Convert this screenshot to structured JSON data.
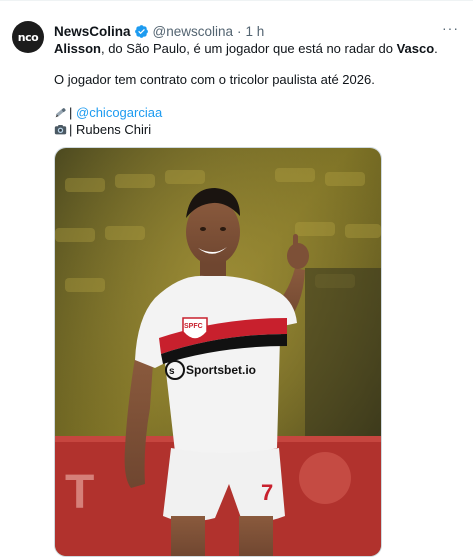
{
  "tweet": {
    "display_name": "NewsColina",
    "handle": "@newscolina",
    "separator": "·",
    "time": "1 h",
    "more": "···",
    "avatar_text": "nco",
    "text": {
      "part1_bold": "Alisson",
      "part1": ", do São Paulo, é um jogador que está no radar do ",
      "part1_bold2": "Vasco",
      "part1_end": ".",
      "line2": "O jogador tem contrato com o tricolor paulista até 2026.",
      "credit_prefix_1": "| ",
      "credit_link": "@chicogarciaa",
      "credit_photo": "| Rubens Chiri"
    },
    "icons": {
      "verified": "verified-badge-icon",
      "pen": "pen-emoji-icon",
      "camera": "camera-emoji-icon"
    },
    "colors": {
      "link": "#1d9bf0",
      "verified": "#1d9bf0",
      "secondary": "#536471"
    },
    "image": {
      "jersey_sponsor": "Sportsbet.io",
      "jersey_crest": "SPFC",
      "shorts_number": "7"
    }
  }
}
